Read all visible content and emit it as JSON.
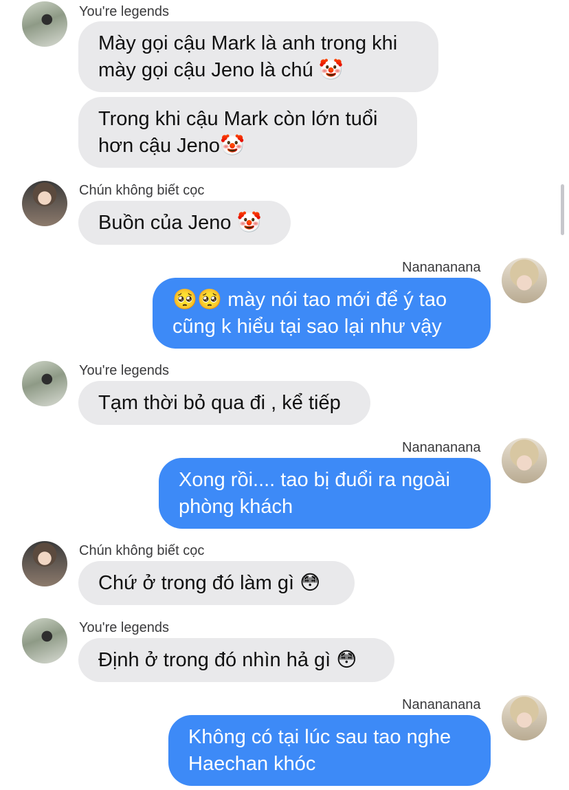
{
  "messages": [
    {
      "sender": "You're legends",
      "lines": [
        "Mày gọi cậu Mark là anh trong khi",
        "mày gọi cậu Jeno là chú 🤡",
        "Trong khi cậu Mark còn lớn tuổi",
        "hơn cậu Jeno🤡"
      ]
    },
    {
      "sender": "Chún không biết cọc",
      "lines": [
        "Buồn của Jeno 🤡"
      ]
    },
    {
      "sender": "Nanananana",
      "lines": [
        "🥺🥺 mày nói tao mới để ý tao",
        "cũng k hiểu tại sao lại như vậy"
      ]
    },
    {
      "sender": "You're legends",
      "lines": [
        "Tạm thời bỏ qua đi , kể tiếp"
      ]
    },
    {
      "sender": "Nanananana",
      "lines": [
        "Xong rồi.... tao bị đuổi ra ngoài",
        "phòng khách"
      ]
    },
    {
      "sender": "Chún không biết cọc",
      "lines": [
        "Chứ ở trong đó làm gì 😳"
      ]
    },
    {
      "sender": "You're legends",
      "lines": [
        "Định ở trong đó nhìn hả gì 😳"
      ]
    },
    {
      "sender": "Nanananana",
      "lines": [
        "Không có tại lúc sau tao nghe",
        "Haechan khóc"
      ]
    }
  ],
  "colors": {
    "incoming_bubble": "#e9e9eb",
    "outgoing_bubble": "#3d8af7"
  }
}
